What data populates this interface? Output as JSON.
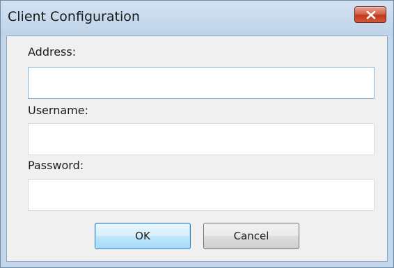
{
  "window": {
    "title": "Client Configuration",
    "close_icon": "close-icon"
  },
  "form": {
    "address": {
      "label": "Address:",
      "value": ""
    },
    "username": {
      "label": "Username:",
      "value": ""
    },
    "password": {
      "label": "Password:",
      "value": ""
    }
  },
  "buttons": {
    "ok": "OK",
    "cancel": "Cancel"
  },
  "colors": {
    "close_button": "#c2391c",
    "focus_border": "#7fb4e0",
    "default_button": "#3c7fb1"
  }
}
